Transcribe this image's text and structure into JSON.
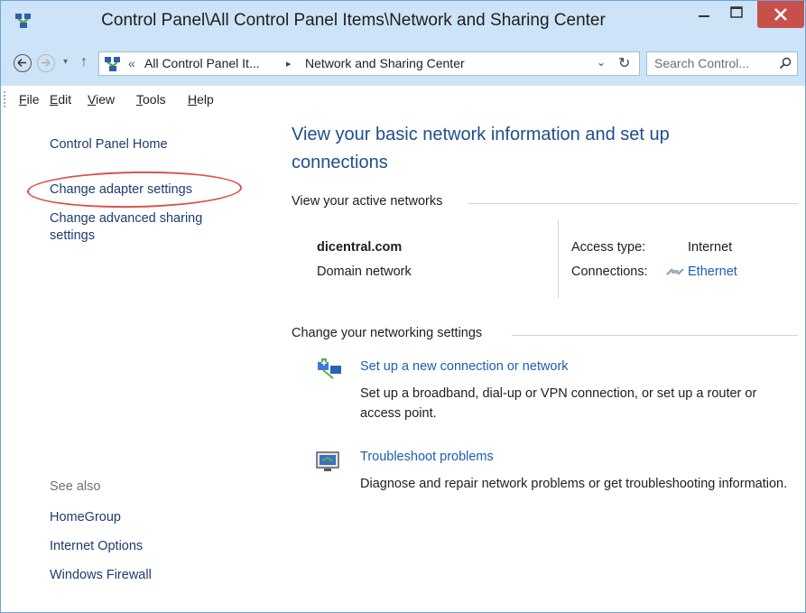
{
  "window": {
    "title": "Control Panel\\All Control Panel Items\\Network and Sharing Center"
  },
  "address": {
    "overflow": "«",
    "crumb1": "All Control Panel It...",
    "separator": "▸",
    "crumb2": "Network and Sharing Center",
    "dropdown": "⌄",
    "refresh": "↻"
  },
  "search": {
    "placeholder": "Search Control..."
  },
  "nav": {
    "up": "↑",
    "recent": "▾"
  },
  "menu": {
    "file_u": "F",
    "file_rest": "ile",
    "edit_u": "E",
    "edit_rest": "dit",
    "view_u": "V",
    "view_rest": "iew",
    "tools_u": "T",
    "tools_rest": "ools",
    "help_u": "H",
    "help_rest": "elp"
  },
  "sidebar": {
    "home": "Control Panel Home",
    "adapter": "Change adapter settings",
    "advanced_line1": "Change advanced sharing",
    "advanced_line2": "settings",
    "see_also": "See also",
    "homegroup": "HomeGroup",
    "internet_options": "Internet Options",
    "firewall": "Windows Firewall"
  },
  "main": {
    "title": "View your basic network information and set up connections",
    "active_networks_heading": "View your active networks",
    "network": {
      "name": "dicentral.com",
      "type": "Domain network",
      "access_label": "Access type:",
      "access_value": "Internet",
      "connections_label": "Connections:",
      "connection_link": "Ethernet"
    },
    "settings_heading": "Change your networking settings",
    "tasks": [
      {
        "link": "Set up a new connection or network",
        "description": "Set up a broadband, dial-up or VPN connection, or set up a router or access point.",
        "icon": "new-connection-icon"
      },
      {
        "link": "Troubleshoot problems",
        "description": "Diagnose and repair network problems or get troubleshooting information.",
        "icon": "troubleshoot-icon"
      }
    ]
  },
  "colors": {
    "chrome": "#cde3f7",
    "close_button": "#c7504c",
    "link": "#1a5fb4",
    "title": "#1e4f8a",
    "highlight": "#d9534f"
  }
}
